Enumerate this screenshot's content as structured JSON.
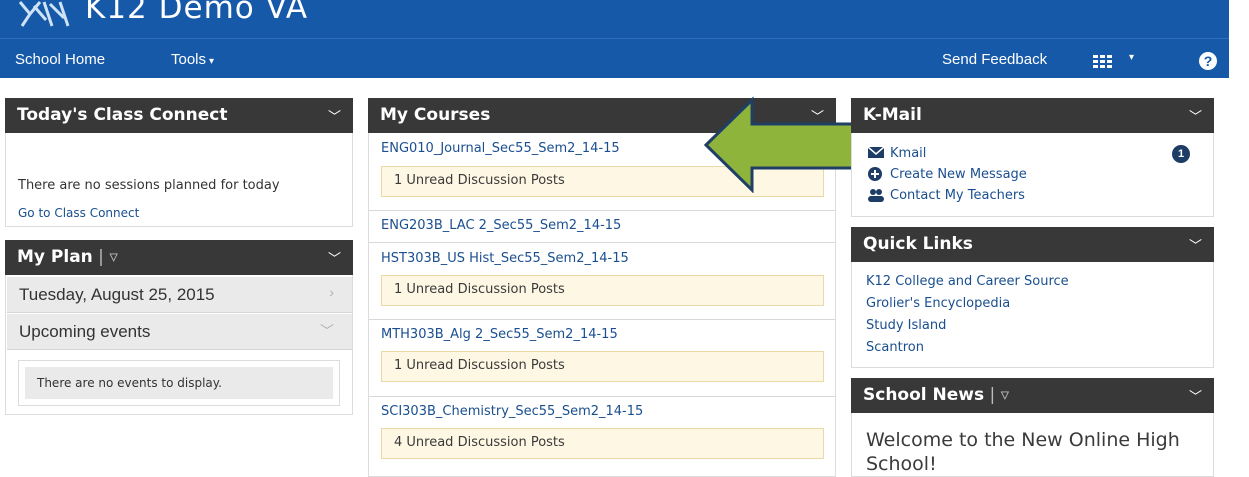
{
  "header": {
    "app_title": "K12 Demo VA",
    "nav": {
      "school_home": "School Home",
      "tools": "Tools",
      "send_feedback": "Send Feedback",
      "help_symbol": "?"
    }
  },
  "class_connect": {
    "title": "Today's Class Connect",
    "no_sessions": "There are no sessions planned for today",
    "go_link": "Go to Class Connect"
  },
  "my_plan": {
    "title": "My Plan",
    "date": "Tuesday, August 25, 2015",
    "upcoming": "Upcoming events",
    "no_events": "There are no events to display."
  },
  "my_courses": {
    "title": "My Courses",
    "courses": [
      {
        "name": "ENG010_Journal_Sec55_Sem2_14-15",
        "notice": "1 Unread Discussion Posts"
      },
      {
        "name": "ENG203B_LAC 2_Sec55_Sem2_14-15",
        "notice": ""
      },
      {
        "name": "HST303B_US Hist_Sec55_Sem2_14-15",
        "notice": "1 Unread Discussion Posts"
      },
      {
        "name": "MTH303B_Alg 2_Sec55_Sem2_14-15",
        "notice": "1 Unread Discussion Posts"
      },
      {
        "name": "SCI303B_Chemistry_Sec55_Sem2_14-15",
        "notice": "4 Unread Discussion Posts"
      }
    ]
  },
  "kmail": {
    "title": "K-Mail",
    "kmail_label": "Kmail",
    "kmail_count": "1",
    "create": "Create New Message",
    "contact": "Contact My Teachers"
  },
  "quick_links": {
    "title": "Quick Links",
    "links": [
      "K12 College and Career Source",
      "Grolier's Encyclopedia",
      "Study Island",
      "Scantron"
    ]
  },
  "school_news": {
    "title": "School News",
    "headline": "Welcome to the New Online High School!"
  },
  "colors": {
    "header_blue": "#1559a8",
    "panel_dark": "#383838",
    "arrow_green": "#8fb43c"
  }
}
